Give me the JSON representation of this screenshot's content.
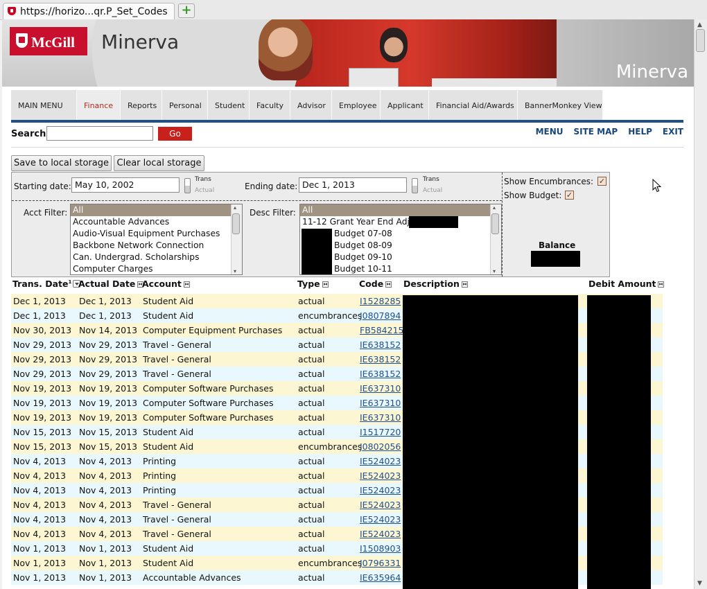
{
  "browser": {
    "tab_title": "https://horizo...qr.P_Set_Codes",
    "new_tab_icon": "plus-icon"
  },
  "banner": {
    "logo_text": "McGill",
    "brand": "Minerva",
    "brand_right": "Minerva"
  },
  "nav": {
    "tabs": [
      "MAIN MENU",
      "Finance",
      "Reports",
      "Personal",
      "Student",
      "Faculty",
      "Advisor",
      "Employee",
      "Applicant",
      "Financial Aid/Awards",
      "BannerMonkey View"
    ],
    "active": "Finance",
    "accent_color": "#20508a"
  },
  "search": {
    "label": "Search",
    "value": "",
    "go_label": "Go"
  },
  "top_links": [
    "MENU",
    "SITE MAP",
    "HELP",
    "EXIT"
  ],
  "storage": {
    "save_label": "Save to local storage",
    "clear_label": "Clear local storage"
  },
  "filters": {
    "start_label": "Starting date:",
    "start_value": "May 10, 2002",
    "end_label": "Ending date:",
    "end_value": "Dec 1, 2013",
    "toggle_on": "Trans",
    "toggle_off": "Actual",
    "acct_label": "Acct Filter:",
    "acct_options": [
      "All",
      "Accountable Advances",
      "Audio-Visual Equipment Purchases",
      "Backbone Network Connection",
      "Can. Undergrad. Scholarships",
      "Computer Charges"
    ],
    "desc_label": "Desc Filter:",
    "desc_options": [
      "All",
      "11-12 Grant Year End Adj",
      "Budget 07-08",
      "Budget 08-09",
      "Budget 09-10",
      "Budget 10-11"
    ],
    "show_encumbrances_label": "Show Encumbrances:",
    "show_encumbrances": true,
    "show_budget_label": "Show Budget:",
    "show_budget": true,
    "balance_label": "Balance"
  },
  "table": {
    "headers": {
      "trans_date": "Trans. Date",
      "trans_date_note": "1",
      "actual_date": "Actual Date",
      "account": "Account",
      "type": "Type",
      "code": "Code",
      "description": "Description",
      "debit": "Debit Amount"
    },
    "rows": [
      {
        "trans_date": "Dec 1, 2013",
        "actual_date": "Dec 1, 2013",
        "account": "Student Aid",
        "type": "actual",
        "code": "I1528285"
      },
      {
        "trans_date": "Dec 1, 2013",
        "actual_date": "Dec 1, 2013",
        "account": "Student Aid",
        "type": "encumbrances",
        "code": "J0807894"
      },
      {
        "trans_date": "Nov 30, 2013",
        "actual_date": "Nov 14, 2013",
        "account": "Computer Equipment Purchases",
        "type": "actual",
        "code": "FB584215"
      },
      {
        "trans_date": "Nov 29, 2013",
        "actual_date": "Nov 29, 2013",
        "account": "Travel - General",
        "type": "actual",
        "code": "IE638152"
      },
      {
        "trans_date": "Nov 29, 2013",
        "actual_date": "Nov 29, 2013",
        "account": "Travel - General",
        "type": "actual",
        "code": "IE638152"
      },
      {
        "trans_date": "Nov 29, 2013",
        "actual_date": "Nov 29, 2013",
        "account": "Travel - General",
        "type": "actual",
        "code": "IE638152"
      },
      {
        "trans_date": "Nov 19, 2013",
        "actual_date": "Nov 19, 2013",
        "account": "Computer Software Purchases",
        "type": "actual",
        "code": "IE637310"
      },
      {
        "trans_date": "Nov 19, 2013",
        "actual_date": "Nov 19, 2013",
        "account": "Computer Software Purchases",
        "type": "actual",
        "code": "IE637310"
      },
      {
        "trans_date": "Nov 19, 2013",
        "actual_date": "Nov 19, 2013",
        "account": "Computer Software Purchases",
        "type": "actual",
        "code": "IE637310"
      },
      {
        "trans_date": "Nov 15, 2013",
        "actual_date": "Nov 15, 2013",
        "account": "Student Aid",
        "type": "actual",
        "code": "I1517720"
      },
      {
        "trans_date": "Nov 15, 2013",
        "actual_date": "Nov 15, 2013",
        "account": "Student Aid",
        "type": "encumbrances",
        "code": "J0802056"
      },
      {
        "trans_date": "Nov 4, 2013",
        "actual_date": "Nov 4, 2013",
        "account": "Printing",
        "type": "actual",
        "code": "IE524023"
      },
      {
        "trans_date": "Nov 4, 2013",
        "actual_date": "Nov 4, 2013",
        "account": "Printing",
        "type": "actual",
        "code": "IE524023"
      },
      {
        "trans_date": "Nov 4, 2013",
        "actual_date": "Nov 4, 2013",
        "account": "Printing",
        "type": "actual",
        "code": "IE524023"
      },
      {
        "trans_date": "Nov 4, 2013",
        "actual_date": "Nov 4, 2013",
        "account": "Travel - General",
        "type": "actual",
        "code": "IE524023"
      },
      {
        "trans_date": "Nov 4, 2013",
        "actual_date": "Nov 4, 2013",
        "account": "Travel - General",
        "type": "actual",
        "code": "IE524023"
      },
      {
        "trans_date": "Nov 4, 2013",
        "actual_date": "Nov 4, 2013",
        "account": "Travel - General",
        "type": "actual",
        "code": "IE524023"
      },
      {
        "trans_date": "Nov 1, 2013",
        "actual_date": "Nov 1, 2013",
        "account": "Student Aid",
        "type": "actual",
        "code": "I1508903"
      },
      {
        "trans_date": "Nov 1, 2013",
        "actual_date": "Nov 1, 2013",
        "account": "Student Aid",
        "type": "encumbrances",
        "code": "J0796331"
      },
      {
        "trans_date": "Nov 1, 2013",
        "actual_date": "Nov 1, 2013",
        "account": "Accountable Advances",
        "type": "actual",
        "code": "IE635964"
      }
    ]
  },
  "colors": {
    "row_odd": "#fcf7d2",
    "row_even": "#e9f8fc",
    "link": "#1f4f8f",
    "go_button": "#c8201a",
    "selected_list_item": "#a19381"
  }
}
